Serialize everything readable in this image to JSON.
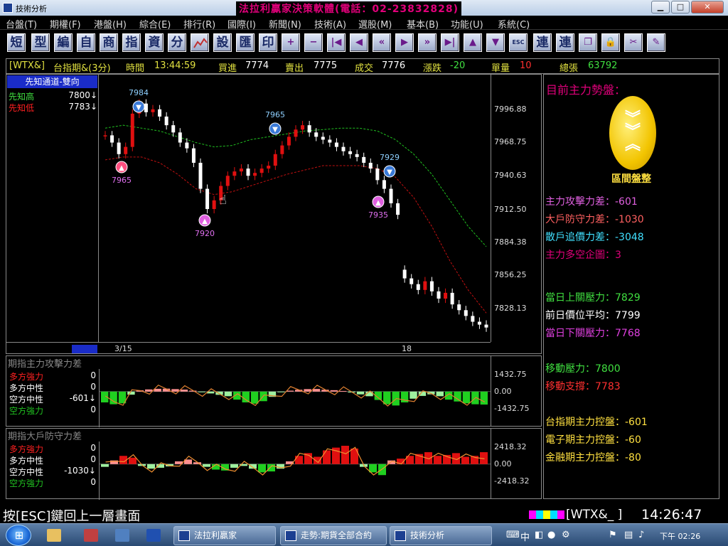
{
  "window": {
    "title": "技術分析",
    "banner": "法拉利贏家決策軟體(電話：02-23832828)",
    "min": "▁",
    "max": "□",
    "close": "✕"
  },
  "menu": [
    "台盤(T)",
    "期權(F)",
    "港盤(H)",
    "綜合(E)",
    "排行(R)",
    "國際(I)",
    "新聞(N)",
    "技術(A)",
    "選股(M)",
    "基本(B)",
    "功能(U)",
    "系統(C)"
  ],
  "toolbar": {
    "text_buttons": [
      "短",
      "型",
      "編",
      "自",
      "商",
      "指",
      "資",
      "分"
    ],
    "mid_buttons": [
      "設",
      "匯",
      "印"
    ],
    "right_buttons": [
      "連",
      "連"
    ],
    "esc_label": "ESC"
  },
  "quote": {
    "symbol": "[WTX&]",
    "name": "台指期&(3分)",
    "time_label": "時間",
    "time": "13:44:59",
    "bid_label": "買進",
    "bid": "7774",
    "ask_label": "賣出",
    "ask": "7775",
    "trade_label": "成交",
    "trade": "7776",
    "chg_label": "漲跌",
    "chg": "-20",
    "vol_label": "單量",
    "vol": "10",
    "total_label": "總張",
    "total": "63792"
  },
  "left_panel": {
    "header": "先知通道-雙向",
    "rows": [
      {
        "label": "先知高",
        "value": "7800↓",
        "color": "#ffffff"
      },
      {
        "label": "先知低",
        "value": "7783↓",
        "color": "#ff2020"
      }
    ]
  },
  "price_chart": {
    "yticks": [
      "7996.88",
      "7968.75",
      "7940.63",
      "7912.50",
      "7884.38",
      "7856.25",
      "7828.13"
    ],
    "dates": [
      "3/15",
      "18"
    ],
    "markers": [
      {
        "label": "7984",
        "kind": "sell"
      },
      {
        "label": "7965",
        "kind": "buy-red"
      },
      {
        "label": "7965",
        "kind": "sell"
      },
      {
        "label": "7920",
        "kind": "buy"
      },
      {
        "label": "7929",
        "kind": "sell"
      },
      {
        "label": "7935",
        "kind": "buy"
      }
    ]
  },
  "chart_data": [
    {
      "type": "line",
      "title": "台指期&(3分)",
      "xlabel": "",
      "ylabel": "",
      "ylim": [
        7820,
        8005
      ],
      "x_tick_labels": [
        "3/15",
        "18"
      ],
      "series": [
        {
          "name": "close",
          "values": [
            7963,
            7958,
            7950,
            7955,
            7978,
            7985,
            7979,
            7981,
            7976,
            7970,
            7965,
            7958,
            7954,
            7944,
            7926,
            7912,
            7918,
            7928,
            7935,
            7938,
            7940,
            7935,
            7937,
            7940,
            7942,
            7950,
            7956,
            7962,
            7967,
            7970,
            7965,
            7962,
            7960,
            7958,
            7955,
            7952,
            7950,
            7948,
            7944,
            7940,
            7932,
            7926,
            7916,
            7908,
            7864,
            7860,
            7856,
            7862,
            7855,
            7850,
            7854,
            7846,
            7842,
            7838,
            7834,
            7832,
            7830
          ]
        },
        {
          "name": "channel-upper",
          "values": [
            7968,
            7970,
            7968,
            7966,
            7962,
            7958,
            7955,
            7956,
            7960,
            7962,
            7964,
            7966,
            7967,
            7968,
            7968,
            7966,
            7960,
            7950,
            7936,
            7918,
            7900,
            7886
          ]
        },
        {
          "name": "channel-lower",
          "values": [
            7946,
            7948,
            7948,
            7944,
            7936,
            7926,
            7922,
            7924,
            7928,
            7932,
            7936,
            7939,
            7942,
            7942,
            7942,
            7940,
            7934,
            7920,
            7900,
            7876,
            7856,
            7840
          ]
        }
      ]
    },
    {
      "type": "bar",
      "title": "期指主力攻擊力差",
      "ylim": [
        -1432.75,
        1432.75
      ],
      "series": [
        {
          "name": "期指主力攻擊力差",
          "values": [
            -700,
            -820,
            -760,
            -200,
            80,
            140,
            180,
            190,
            160,
            130,
            60,
            -40,
            -120,
            -210,
            -300,
            -520,
            -700,
            -780,
            -620,
            -340,
            -40,
            60,
            120,
            160,
            170,
            120,
            90,
            40,
            -60,
            -180,
            -300,
            -540,
            -820,
            -900,
            -700,
            -460,
            -280,
            -180,
            -300,
            -520,
            -640,
            -760,
            -820,
            -840
          ]
        }
      ]
    },
    {
      "type": "bar",
      "title": "期指大戶防守力差",
      "ylim": [
        -2418.32,
        2418.32
      ],
      "series": [
        {
          "name": "期指大戶防守力差",
          "values": [
            -300,
            400,
            900,
            700,
            -200,
            -500,
            -400,
            -250,
            300,
            500,
            200,
            -300,
            -600,
            -700,
            -400,
            -200,
            -500,
            -900,
            -800,
            -500,
            300,
            900,
            1200,
            800,
            1500,
            1800,
            2000,
            1700,
            -300,
            -900,
            -1200,
            400,
            600,
            900,
            1100,
            1300,
            900,
            1000,
            1200,
            800,
            900,
            1300
          ]
        }
      ]
    }
  ],
  "ind1": {
    "title": "期指主力攻擊力差",
    "rows": [
      {
        "label": "多方強力",
        "value": "0",
        "color": "#ff2020"
      },
      {
        "label": "多方中性",
        "value": "0",
        "color": "#ffffff"
      },
      {
        "label": "空方中性",
        "value": "-601↓",
        "color": "#ffffff"
      },
      {
        "label": "空方強力",
        "value": "0",
        "color": "#20c020"
      }
    ],
    "yticks": [
      "1432.75",
      "0.00",
      "-1432.75"
    ]
  },
  "ind2": {
    "title": "期指大戶防守力差",
    "rows": [
      {
        "label": "多方強力",
        "value": "0",
        "color": "#ff2020"
      },
      {
        "label": "多方中性",
        "value": "0",
        "color": "#ffffff"
      },
      {
        "label": "空方中性",
        "value": "-1030↓",
        "color": "#ffffff"
      },
      {
        "label": "空方強力",
        "value": "0",
        "color": "#20c020"
      }
    ],
    "yticks": [
      "2418.32",
      "0.00",
      "-2418.32"
    ]
  },
  "right_panel": {
    "title": "目前主力勢盤：",
    "state": "區間盤整",
    "lines": [
      {
        "text": "主力攻擊力差：-601",
        "color": "#e060e0"
      },
      {
        "text": "大戶防守力差：-1030",
        "color": "#ff6060"
      },
      {
        "text": "散戶追價力差：-3048",
        "color": "#40e0ff"
      },
      {
        "text": "主力多空企圖：3",
        "color": "#e0007a"
      },
      {
        "text": "當日上關壓力：7829",
        "color": "#40e040"
      },
      {
        "text": "前日價位平均：7799",
        "color": "#ffffff"
      },
      {
        "text": "當日下關壓力：7768",
        "color": "#e040e0"
      },
      {
        "text": "移動壓力：7800",
        "color": "#40e040"
      },
      {
        "text": "移動支撐：7783",
        "color": "#ff3030"
      },
      {
        "text": "台指期主力控盤：-601",
        "color": "#ffe040"
      },
      {
        "text": "電子期主力控盤：-60",
        "color": "#ffe040"
      },
      {
        "text": "金融期主力控盤：-80",
        "color": "#ffe040"
      }
    ]
  },
  "status": {
    "text": "按[ESC]鍵回上一層畫面",
    "code": "[WTX&_ ]",
    "time": "14:26:47"
  },
  "taskbar": {
    "tasks": [
      "法拉利贏家",
      "走勢:期貨全部合約",
      "技術分析"
    ],
    "ime": "中",
    "clock": "下午 02:26"
  },
  "colors": {
    "up": "#e01010",
    "down": "#ffffff",
    "green": "#20d020",
    "pink": "#ff9090",
    "accent": "#1a2cc8"
  }
}
